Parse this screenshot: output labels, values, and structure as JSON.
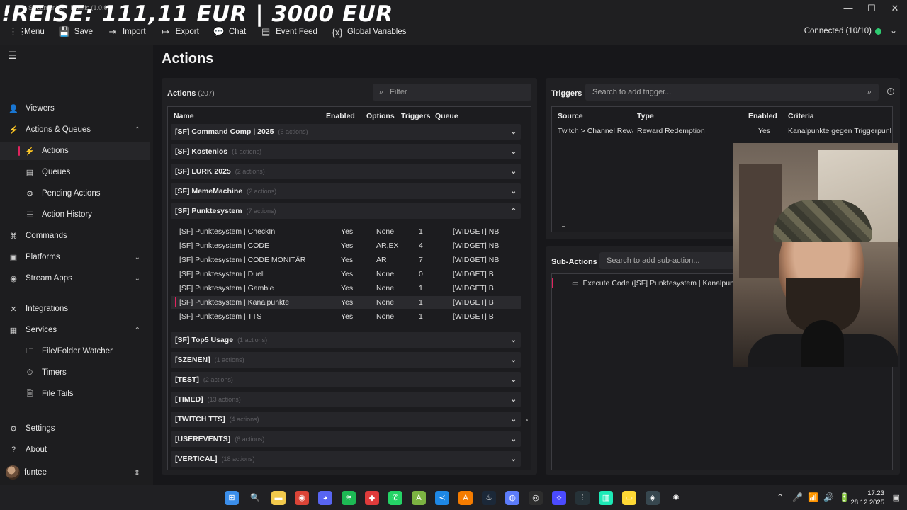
{
  "overlay": {
    "title": "!REISE: 111,11 EUR | 3000 EUR",
    "window_title": "Streamer.bot - Mantis (1.0.0)"
  },
  "window_controls": {
    "minimize": "—",
    "maximize": "☐",
    "close": "✕"
  },
  "menubar": {
    "items": [
      {
        "label": "Menu",
        "icon": "grid-icon",
        "glyph": "⋮⋮"
      },
      {
        "label": "Save",
        "icon": "save-icon",
        "glyph": "💾"
      },
      {
        "label": "Import",
        "icon": "import-icon",
        "glyph": "⇥"
      },
      {
        "label": "Export",
        "icon": "export-icon",
        "glyph": "↦"
      },
      {
        "label": "Chat",
        "icon": "chat-icon",
        "glyph": "💬"
      },
      {
        "label": "Event Feed",
        "icon": "feed-icon",
        "glyph": "▤"
      },
      {
        "label": "Global Variables",
        "icon": "variables-icon",
        "glyph": "{x}"
      }
    ],
    "connection": {
      "label": "Connected (10/10)",
      "status_color": "#2ecc71"
    }
  },
  "sidebar": {
    "items": [
      {
        "label": "Viewers",
        "icon": "viewers-icon",
        "glyph": "👤",
        "level": "top",
        "chev": ""
      },
      {
        "label": "Actions & Queues",
        "icon": "actions-icon",
        "glyph": "⚡",
        "level": "top",
        "chev": "⌃"
      },
      {
        "label": "Actions",
        "icon": "action-icon",
        "glyph": "⚡",
        "level": "sub",
        "chev": "",
        "active": true
      },
      {
        "label": "Queues",
        "icon": "queue-icon",
        "glyph": "▤",
        "level": "sub",
        "chev": ""
      },
      {
        "label": "Pending Actions",
        "icon": "pending-icon",
        "glyph": "⚙",
        "level": "sub",
        "chev": ""
      },
      {
        "label": "Action History",
        "icon": "history-icon",
        "glyph": "☰",
        "level": "sub",
        "chev": ""
      },
      {
        "label": "Commands",
        "icon": "command-icon",
        "glyph": "⌘",
        "level": "top",
        "chev": ""
      },
      {
        "label": "Platforms",
        "icon": "platforms-icon",
        "glyph": "▣",
        "level": "top",
        "chev": "⌄"
      },
      {
        "label": "Stream Apps",
        "icon": "stream-apps-icon",
        "glyph": "◉",
        "level": "top",
        "chev": "⌄"
      },
      {
        "label": "Integrations",
        "icon": "integrations-icon",
        "glyph": "✕",
        "level": "top",
        "chev": ""
      },
      {
        "label": "Services",
        "icon": "services-icon",
        "glyph": "▦",
        "level": "top",
        "chev": "⌃"
      },
      {
        "label": "File/Folder Watcher",
        "icon": "folder-watch-icon",
        "glyph": "🗀",
        "level": "sub",
        "chev": ""
      },
      {
        "label": "Timers",
        "icon": "timer-icon",
        "glyph": "⏱",
        "level": "sub",
        "chev": ""
      },
      {
        "label": "File Tails",
        "icon": "file-tail-icon",
        "glyph": "🗎",
        "level": "sub",
        "chev": ""
      },
      {
        "label": "Settings",
        "icon": "settings-icon",
        "glyph": "⚙",
        "level": "top",
        "chev": ""
      },
      {
        "label": "About",
        "icon": "about-icon",
        "glyph": "?",
        "level": "top",
        "chev": ""
      }
    ],
    "user": {
      "name": "funtee",
      "chev": "⇕"
    }
  },
  "main": {
    "title": "Actions",
    "actions": {
      "header": "Actions",
      "count": "(207)",
      "filter_placeholder": "Filter",
      "columns": [
        "Name",
        "Enabled",
        "Options",
        "Triggers",
        "Queue"
      ],
      "groups_before": [
        {
          "name": "[SF] Command Comp | 2025",
          "count": "(6 actions)",
          "chev": "⌄"
        },
        {
          "name": "[SF] Kostenlos",
          "count": "(1 actions)",
          "chev": "⌄"
        },
        {
          "name": "[SF] LURK 2025",
          "count": "(2 actions)",
          "chev": "⌄"
        },
        {
          "name": "[SF] MemeMachine",
          "count": "(2 actions)",
          "chev": "⌄"
        },
        {
          "name": "[SF] Punktesystem",
          "count": "(7 actions)",
          "chev": "⌃"
        }
      ],
      "rows": [
        {
          "name": "[SF] Punktesystem | CheckIn",
          "enabled": "Yes",
          "options": "None",
          "triggers": "1",
          "queue": "[WIDGET] NB"
        },
        {
          "name": "[SF] Punktesystem | CODE",
          "enabled": "Yes",
          "options": "AR,EX",
          "triggers": "4",
          "queue": "[WIDGET] NB"
        },
        {
          "name": "[SF] Punktesystem | CODE MONITÄR",
          "enabled": "Yes",
          "options": "AR",
          "triggers": "7",
          "queue": "[WIDGET] NB"
        },
        {
          "name": "[SF] Punktesystem | Duell",
          "enabled": "Yes",
          "options": "None",
          "triggers": "0",
          "queue": "[WIDGET] B"
        },
        {
          "name": "[SF] Punktesystem | Gamble",
          "enabled": "Yes",
          "options": "None",
          "triggers": "1",
          "queue": "[WIDGET] B"
        },
        {
          "name": "[SF] Punktesystem | Kanalpunkte",
          "enabled": "Yes",
          "options": "None",
          "triggers": "1",
          "queue": "[WIDGET] B",
          "selected": true
        },
        {
          "name": "[SF] Punktesystem | TTS",
          "enabled": "Yes",
          "options": "None",
          "triggers": "1",
          "queue": "[WIDGET] B"
        }
      ],
      "groups_after": [
        {
          "name": "[SF] Top5 Usage",
          "count": "(1 actions)",
          "chev": "⌄"
        },
        {
          "name": "[SZENEN]",
          "count": "(1 actions)",
          "chev": "⌄"
        },
        {
          "name": "[TEST]",
          "count": "(2 actions)",
          "chev": "⌄"
        },
        {
          "name": "[TIMED]",
          "count": "(13 actions)",
          "chev": "⌄"
        },
        {
          "name": "[TWITCH TTS]",
          "count": "(4 actions)",
          "chev": "⌄"
        },
        {
          "name": "[USEREVENTS]",
          "count": "(6 actions)",
          "chev": "⌄"
        },
        {
          "name": "[VERTICAL]",
          "count": "(18 actions)",
          "chev": "⌄"
        }
      ]
    },
    "triggers": {
      "header": "Triggers",
      "search_placeholder": "Search to add trigger...",
      "columns": [
        "Source",
        "Type",
        "Enabled",
        "Criteria"
      ],
      "row": {
        "source": "Twitch > Channel Reward",
        "type": "Reward Redemption",
        "enabled": "Yes",
        "criteria": "Kanalpunkte gegen Triggerpunkte"
      }
    },
    "subactions": {
      "header": "Sub-Actions",
      "search_placeholder": "Search to add sub-action...",
      "row": "Execute Code ([SF] Punktesystem | Kanalpunkte)"
    }
  },
  "taskbar": {
    "apps": [
      {
        "icon": "windows-start-icon",
        "color": "#3b8eea",
        "glyph": "⊞"
      },
      {
        "icon": "search-icon",
        "color": "transparent",
        "glyph": "🔍"
      },
      {
        "icon": "file-explorer-icon",
        "color": "#f2c94c",
        "glyph": "▬"
      },
      {
        "icon": "chrome-icon",
        "color": "#db4437",
        "glyph": "◉"
      },
      {
        "icon": "discord-icon",
        "color": "#5865f2",
        "glyph": "◕"
      },
      {
        "icon": "spotify-icon",
        "color": "#1db954",
        "glyph": "≋"
      },
      {
        "icon": "app-red-icon",
        "color": "#e03b3b",
        "glyph": "◆"
      },
      {
        "icon": "whatsapp-icon",
        "color": "#25d366",
        "glyph": "✆"
      },
      {
        "icon": "app-green-icon",
        "color": "#7cb342",
        "glyph": "A"
      },
      {
        "icon": "vscode-icon",
        "color": "#1e88e5",
        "glyph": "≺"
      },
      {
        "icon": "app-orange-icon",
        "color": "#f57c00",
        "glyph": "A"
      },
      {
        "icon": "steam-icon",
        "color": "#1b2838",
        "glyph": "♨"
      },
      {
        "icon": "app-globe-icon",
        "color": "#5c7cfa",
        "glyph": "◍"
      },
      {
        "icon": "obs-icon",
        "color": "#2d2d2d",
        "glyph": "◎"
      },
      {
        "icon": "streamerbot-icon",
        "color": "#4b4bff",
        "glyph": "⟡"
      },
      {
        "icon": "audio-icon",
        "color": "#263238",
        "glyph": "⫶"
      },
      {
        "icon": "waveform-icon",
        "color": "#1de9b6",
        "glyph": "▥"
      },
      {
        "icon": "notes-icon",
        "color": "#fdd835",
        "glyph": "▭"
      },
      {
        "icon": "davinci-icon",
        "color": "#37474f",
        "glyph": "◈"
      },
      {
        "icon": "chatgpt-icon",
        "color": "transparent",
        "glyph": "✺"
      }
    ],
    "tray": [
      "⌃",
      "🎤",
      "📶",
      "🔊",
      "🔋"
    ],
    "time": "17:23",
    "date": "28.12.2025"
  }
}
